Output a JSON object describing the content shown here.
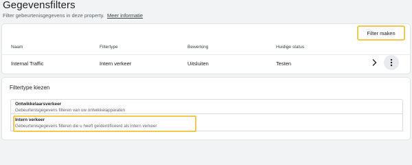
{
  "page": {
    "title": "Gegevensfilters",
    "subtitle": "Filter gebeurtenisgegevens in deze property.",
    "more_info_link": "Meer informatie"
  },
  "filters_table": {
    "create_button_label": "Filter maken",
    "columns": [
      "Naam",
      "Filtertype",
      "Bewerking",
      "Huidige status"
    ],
    "rows": [
      {
        "name": "Internal Traffic",
        "filter_type": "Intern verkeer",
        "operation": "Uitsluiten",
        "status": "Testen"
      }
    ],
    "row_icons": [
      "chevron-right-icon",
      "more-vert-icon"
    ]
  },
  "filter_type_panel": {
    "title": "Filtertype kiezen",
    "options": [
      {
        "title": "Ontwikkelaarsverkeer",
        "description": "Gebeurtenisgegevens filteren van uw ontwikkelapparaten"
      },
      {
        "title": "Intern verkeer",
        "description": "Gebeurtenisgegevens filteren die u heeft geïdentificeerd als intern verkeer"
      }
    ]
  },
  "colors": {
    "highlight": "#f2c94c",
    "background": "#f1f3f4",
    "card": "#ffffff",
    "border": "#dadce0"
  }
}
